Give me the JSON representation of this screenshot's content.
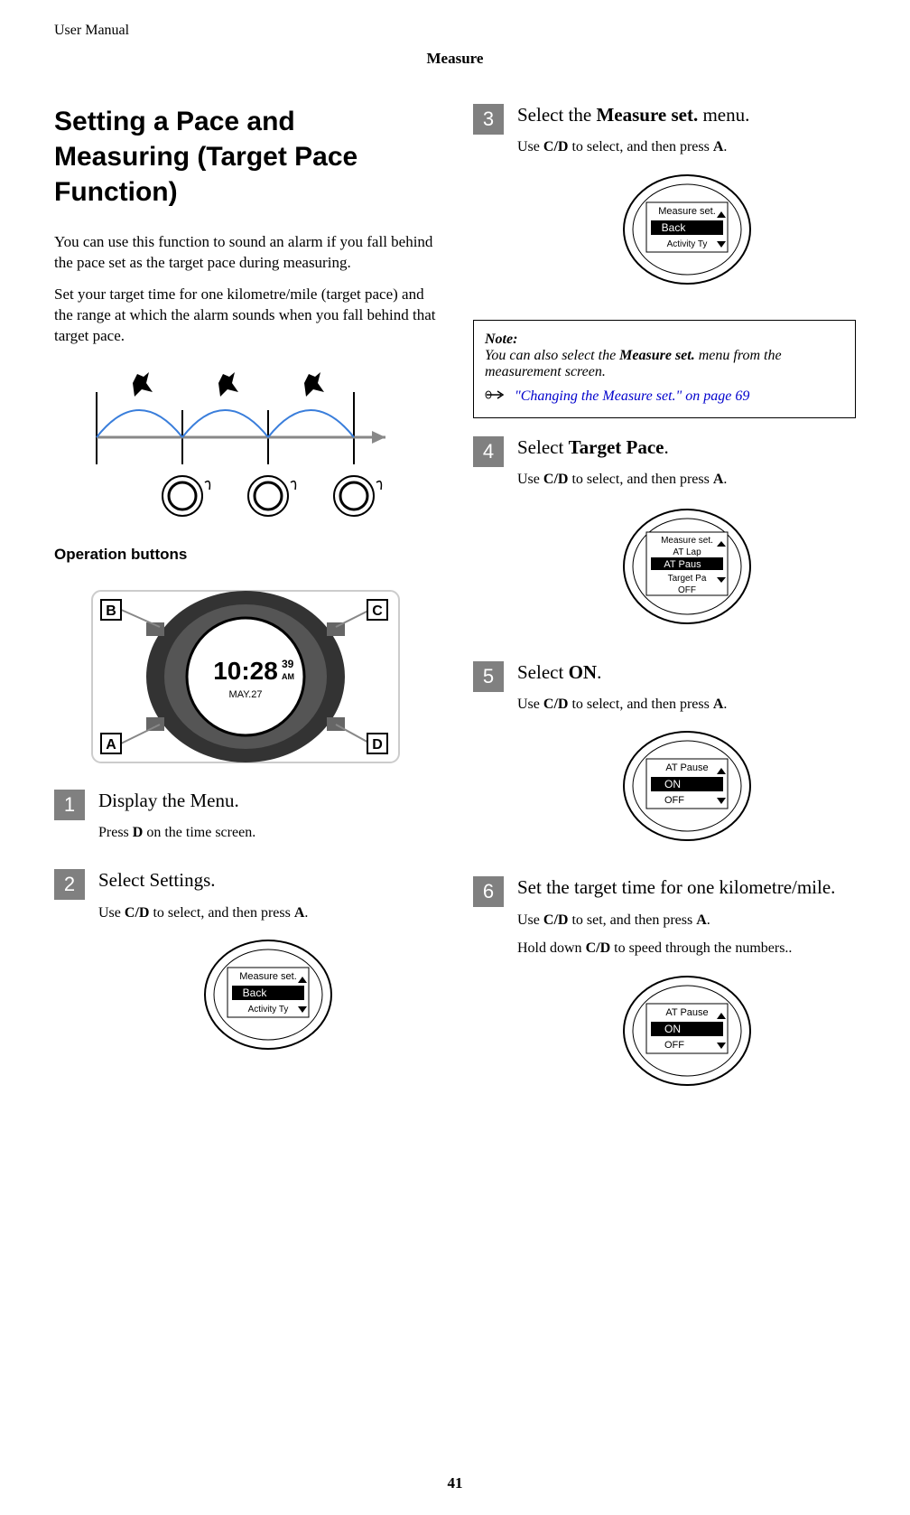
{
  "header": {
    "label": "User Manual",
    "section": "Measure"
  },
  "title": "Setting a Pace and Measuring (Target Pace Function)",
  "intro1": "You can use this function to sound an alarm if you fall behind the pace set as the target pace during measuring.",
  "intro2": "Set your target time for one kilometre/mile (target pace) and the range at which the alarm sounds when you fall behind that target pace.",
  "operation_buttons_label": "Operation buttons",
  "button_labels": {
    "a": "A",
    "b": "B",
    "c": "C",
    "d": "D"
  },
  "steps": {
    "1": {
      "num": "1",
      "title": "Display the Menu.",
      "body_parts": [
        "Press ",
        "D",
        " on the time screen."
      ]
    },
    "2": {
      "num": "2",
      "title": "Select Settings.",
      "body_parts": [
        "Use ",
        "C/D",
        " to select, and then press ",
        "A",
        "."
      ],
      "screen": {
        "title": "Measure set.",
        "highlight": "Back",
        "line2": "Activity Ty"
      }
    },
    "3": {
      "num": "3",
      "title_parts": [
        "Select the ",
        "Measure set.",
        " menu."
      ],
      "body_parts": [
        "Use ",
        "C/D",
        " to select, and then press ",
        "A",
        "."
      ],
      "screen": {
        "title": "Measure set.",
        "highlight": "Back",
        "line2": "Activity Ty"
      }
    },
    "4": {
      "num": "4",
      "title_parts": [
        "Select ",
        "Target Pace",
        "."
      ],
      "body_parts": [
        "Use ",
        "C/D",
        " to select, and then press ",
        "A",
        "."
      ],
      "screen": {
        "title": "Measure set.",
        "line1": "AT Lap",
        "highlight": "AT Paus",
        "line2": "Target Pa",
        "bottom": "OFF"
      }
    },
    "5": {
      "num": "5",
      "title_parts": [
        "Select ",
        "ON",
        "."
      ],
      "body_parts": [
        "Use ",
        "C/D",
        " to select, and then press ",
        "A",
        "."
      ],
      "screen": {
        "title": "AT Pause",
        "highlight": "ON",
        "line2": "OFF"
      }
    },
    "6": {
      "num": "6",
      "title": "Set the target time for one kilometre/mile.",
      "body_parts": [
        "Use ",
        "C/D",
        " to set, and then press ",
        "A",
        "."
      ],
      "body2_parts": [
        "Hold down ",
        "C/D",
        " to speed through the numbers.."
      ],
      "screen": {
        "title": "AT Pause",
        "highlight": "ON",
        "line2": "OFF"
      }
    }
  },
  "note": {
    "title": "Note:",
    "body_parts": [
      "You can also select the ",
      "Measure set.",
      " menu from the measurement screen."
    ],
    "link": "\"Changing the Measure set.\" on page 69"
  },
  "page_number": "41",
  "watch_time": "10:28",
  "watch_sec": "39",
  "watch_ampm": "AM",
  "watch_date": "MAY.27"
}
